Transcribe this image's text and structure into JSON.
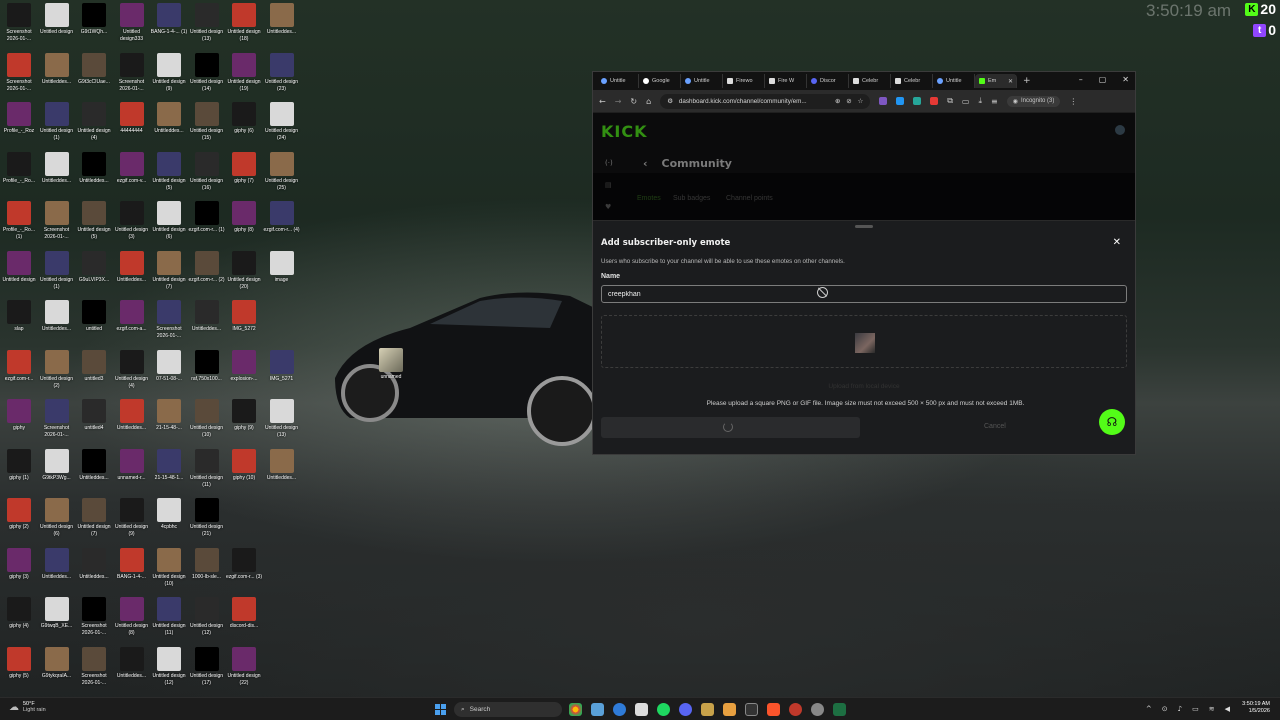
{
  "desktop": {
    "icons": [
      [
        "Screenshot 2026-01-...",
        "Untitled design",
        "G9t1WQh...",
        "Untitled design333",
        "BANG-1-4-... (1)",
        "Untitled design (13)",
        "Untitled design (18)",
        "Untitleddes..."
      ],
      [
        "Screenshot 2026-01-...",
        "Untitleddes...",
        "G9t3cCIUae...",
        "Screenshot 2026-01-...",
        "Untitled design (9)",
        "Untitled design (14)",
        "Untitled design (19)",
        "Untitled design (23)"
      ],
      [
        "Profile_-_Roz",
        "Untitled design (1)",
        "Untitled design (4)",
        "44444444",
        "Untitleddes...",
        "Untitled design (15)",
        "giphy (6)",
        "Untitled design (24)"
      ],
      [
        "Profile_-_Ro...",
        "Untitleddes...",
        "Untitleddes...",
        "ezgif.com-v...",
        "Untitled design (5)",
        "Untitled design (16)",
        "giphy (7)",
        "Untitled design (25)"
      ],
      [
        "Profile_-_Ro... (1)",
        "Screenshot 2026-01-...",
        "Untitled design (5)",
        "Untitled design (3)",
        "Untitled design (6)",
        "ezgif.com-r... (1)",
        "giphy (8)",
        "ezgif.com-r... (4)"
      ],
      [
        "Untitled design",
        "Untitled design (1)",
        "G9uLVIP3X...",
        "Untitleddes...",
        "Untitled design (7)",
        "ezgif.com-r... (2)",
        "Untitled design (20)",
        "image"
      ],
      [
        "slap",
        "Untitleddes...",
        "untitled",
        "ezgif.com-a...",
        "Screenshot 2026-01-...",
        "Untitleddes...",
        "IMG_5272"
      ],
      [
        "ezgif.com-r...",
        "Untitled design (2)",
        "untitled3",
        "Untitled design (4)",
        "07-51-08-...",
        "raf,750x100...",
        "explosion-...",
        "IMG_5271"
      ],
      [
        "giphy",
        "Screenshot 2026-01-...",
        "untitled4",
        "Untitleddes...",
        "21-15-48-...",
        "Untitled design (10)",
        "giphy (9)",
        "Untitled design (13)"
      ],
      [
        "giphy (1)",
        "G9tkP3Wg...",
        "Untitleddes...",
        "unnamed-r...",
        "21-15-48-1...",
        "Untitled design (11)",
        "giphy (10)",
        "Untitleddes..."
      ],
      [
        "giphy (2)",
        "Untitled design (6)",
        "Untitled design (7)",
        "Untitled design (9)",
        "4cpbhc",
        "Untitled design (21)"
      ],
      [
        "giphy (3)",
        "Untitleddes...",
        "Untitleddes...",
        "BANG-1-4-...",
        "Untitled design (10)",
        "1000-lb-sle...",
        "ezgif.com-r... (3)"
      ],
      [
        "giphy (4)",
        "G9twqB_XE...",
        "Screenshot 2026-01-...",
        "Untitled design (8)",
        "Untitled design (11)",
        "Untitled design (12)",
        "discord-dis..."
      ],
      [
        "giphy (5)",
        "G9tykqraIA...",
        "Screenshot 2026-01-...",
        "Untitleddes...",
        "Untitled design (12)",
        "Untitled design (17)",
        "Untitled design (22)"
      ]
    ],
    "unnamed_icon": "unnamed",
    "clock": "3:50:19 am",
    "kick_count": "20",
    "twitch_count": "0"
  },
  "browser": {
    "tabs": [
      "Untitle",
      "Google",
      "Untitle",
      "Firewo",
      "Fire W",
      "Discor",
      "Celebr",
      "Celebr",
      "Untitle",
      "Em"
    ],
    "new_tab": "+",
    "url": "dashboard.kick.com/channel/community/em...",
    "incognito": "Incognito (3)"
  },
  "page": {
    "logo": "KICK",
    "title": "Community",
    "tabs": [
      "Emotes",
      "Sub badges",
      "Channel points"
    ]
  },
  "modal": {
    "title": "Add subscriber-only emote",
    "description": "Users who subscribe to your channel will be able to use these emotes on other channels.",
    "name_label": "Name",
    "name_value": "creepkhan",
    "upload_link": "Upload from local device",
    "hint": "Please upload a square PNG or GIF file. Image size must not exceed 500 × 500 px and must not exceed 1MB.",
    "cancel": "Cancel"
  },
  "taskbar": {
    "weather_temp": "50°F",
    "weather_desc": "Light rain",
    "search": "Search",
    "time": "3:50:19 AM",
    "date": "1/5/2026"
  },
  "colors": {
    "kick_green": "#53fc18",
    "twitch_purple": "#9146ff"
  }
}
